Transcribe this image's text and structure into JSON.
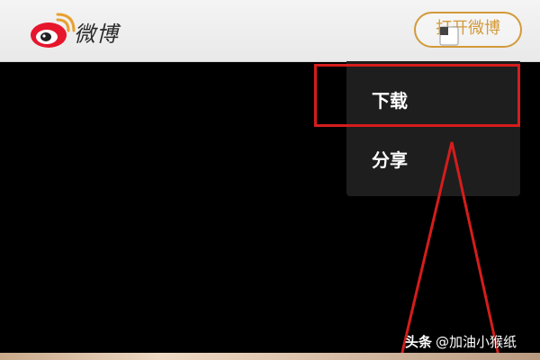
{
  "header": {
    "app_name": "微博",
    "open_button_label": "打开微博",
    "brand_color": "#d39a3a"
  },
  "menu": {
    "items": [
      {
        "label": "下载",
        "icon": "download"
      },
      {
        "label": "分享",
        "icon": "share"
      }
    ]
  },
  "annotation": {
    "color": "#d51c1c"
  },
  "watermark": {
    "brand": "头条",
    "author": "@加油小猴纸"
  }
}
